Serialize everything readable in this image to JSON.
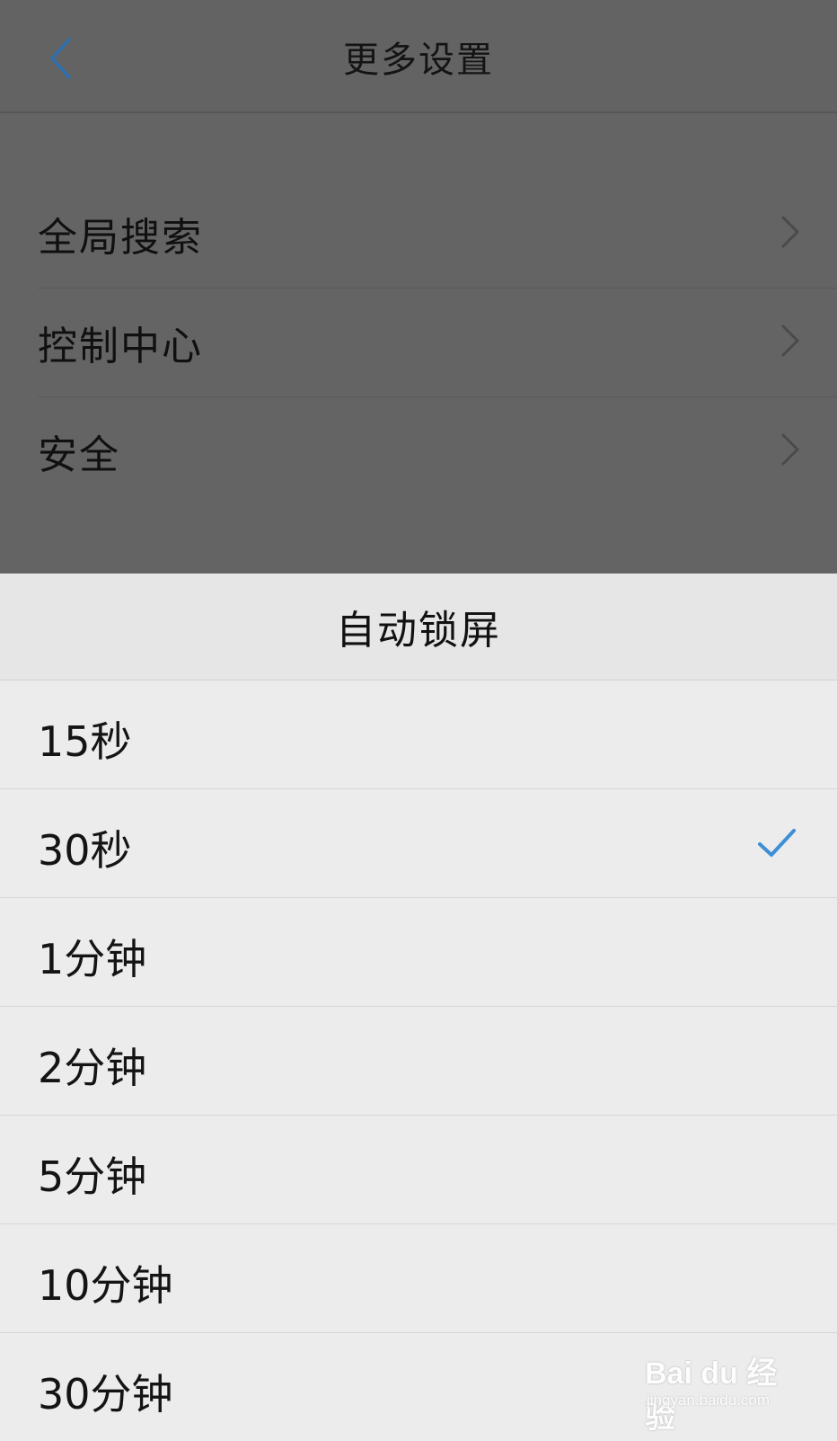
{
  "nav": {
    "title": "更多设置",
    "back_icon": "chevron-left-icon",
    "back_color": "#2d6fb1"
  },
  "settings": {
    "items": [
      {
        "label": "全局搜索"
      },
      {
        "label": "控制中心"
      },
      {
        "label": "安全"
      }
    ]
  },
  "sheet": {
    "title": "自动锁屏",
    "options": [
      {
        "label": "15秒",
        "selected": false
      },
      {
        "label": "30秒",
        "selected": true
      },
      {
        "label": "1分钟",
        "selected": false
      },
      {
        "label": "2分钟",
        "selected": false
      },
      {
        "label": "5分钟",
        "selected": false
      },
      {
        "label": "10分钟",
        "selected": false
      },
      {
        "label": "30分钟",
        "selected": false
      }
    ],
    "check_color": "#3d8fd6"
  },
  "watermark": {
    "brand": "Bai du 经验",
    "url": "jingyan.baidu.com"
  }
}
